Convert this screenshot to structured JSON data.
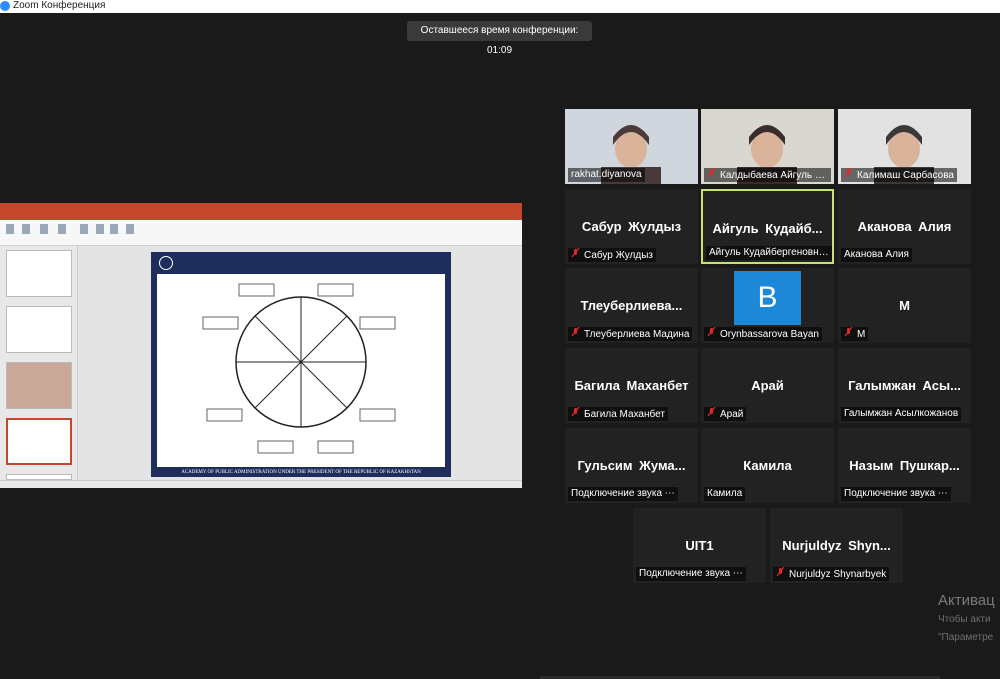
{
  "window": {
    "title": "Zoom Конференция"
  },
  "timer": {
    "text": "Оставшееся время конференции: 01:09"
  },
  "shared_screen": {
    "slide_footer": "ACADEMY OF PUBLIC ADMINISTRATION UNDER THE PRESIDENT OF THE REPUBLIC OF KAZAKHSTAN"
  },
  "participants": [
    {
      "name": "rakhat.diyanova",
      "display": "",
      "muted": false,
      "video": true,
      "active": false
    },
    {
      "name": "Калдыбаева Айгуль К...",
      "display": "",
      "muted": true,
      "video": true,
      "active": false
    },
    {
      "name": "Калимаш Сарбасова",
      "display": "",
      "muted": true,
      "video": true,
      "active": false
    },
    {
      "name": "Сабур Жулдыз",
      "display": "Сабур Жулдыз",
      "muted": true,
      "video": false,
      "active": false
    },
    {
      "name": "Айгуль Кудайбергеновна...",
      "display": "Айгуль Кудайб...",
      "muted": false,
      "video": false,
      "active": true
    },
    {
      "name": "Аканова Алия",
      "display": "Аканова Алия",
      "muted": false,
      "video": false,
      "active": false
    },
    {
      "name": "Тлеуберлиева Мадина",
      "display": "Тлеуберлиева...",
      "muted": true,
      "video": false,
      "active": false
    },
    {
      "name": "Orynbassarova Bayan",
      "display": "B",
      "muted": true,
      "video": false,
      "active": false
    },
    {
      "name": "M",
      "display": "M",
      "muted": true,
      "video": false,
      "active": false
    },
    {
      "name": "Багила Маханбет",
      "display": "Багила Маханбет",
      "muted": true,
      "video": false,
      "active": false
    },
    {
      "name": "Арай",
      "display": "Арай",
      "muted": true,
      "video": false,
      "active": false
    },
    {
      "name": "Галымжан Асылкожанов",
      "display": "Галымжан Асы...",
      "muted": false,
      "video": false,
      "active": false
    },
    {
      "name": "Подключение звука ⋯",
      "display": "Гульсим Жума...",
      "muted": false,
      "video": false,
      "active": false
    },
    {
      "name": "Камила",
      "display": "Камила",
      "muted": false,
      "video": false,
      "active": false
    },
    {
      "name": "Подключение звука ⋯",
      "display": "Назым Пушкар...",
      "muted": false,
      "video": false,
      "active": false
    },
    {
      "name": "Подключение звука ⋯",
      "display": "UIT1",
      "muted": false,
      "video": false,
      "active": false
    },
    {
      "name": "Nurjuldyz Shynarbyek",
      "display": "Nurjuldyz Shyn...",
      "muted": true,
      "video": false,
      "active": false
    }
  ],
  "activation": {
    "line1": "Активац",
    "line2": "Чтобы акти",
    "line3": "\"Параметре"
  },
  "colors": {
    "active_speaker": "#c6e36d",
    "mute_icon": "#e02828",
    "avatar_bg": "#1e88d8",
    "powerpoint_accent": "#c4472b"
  }
}
